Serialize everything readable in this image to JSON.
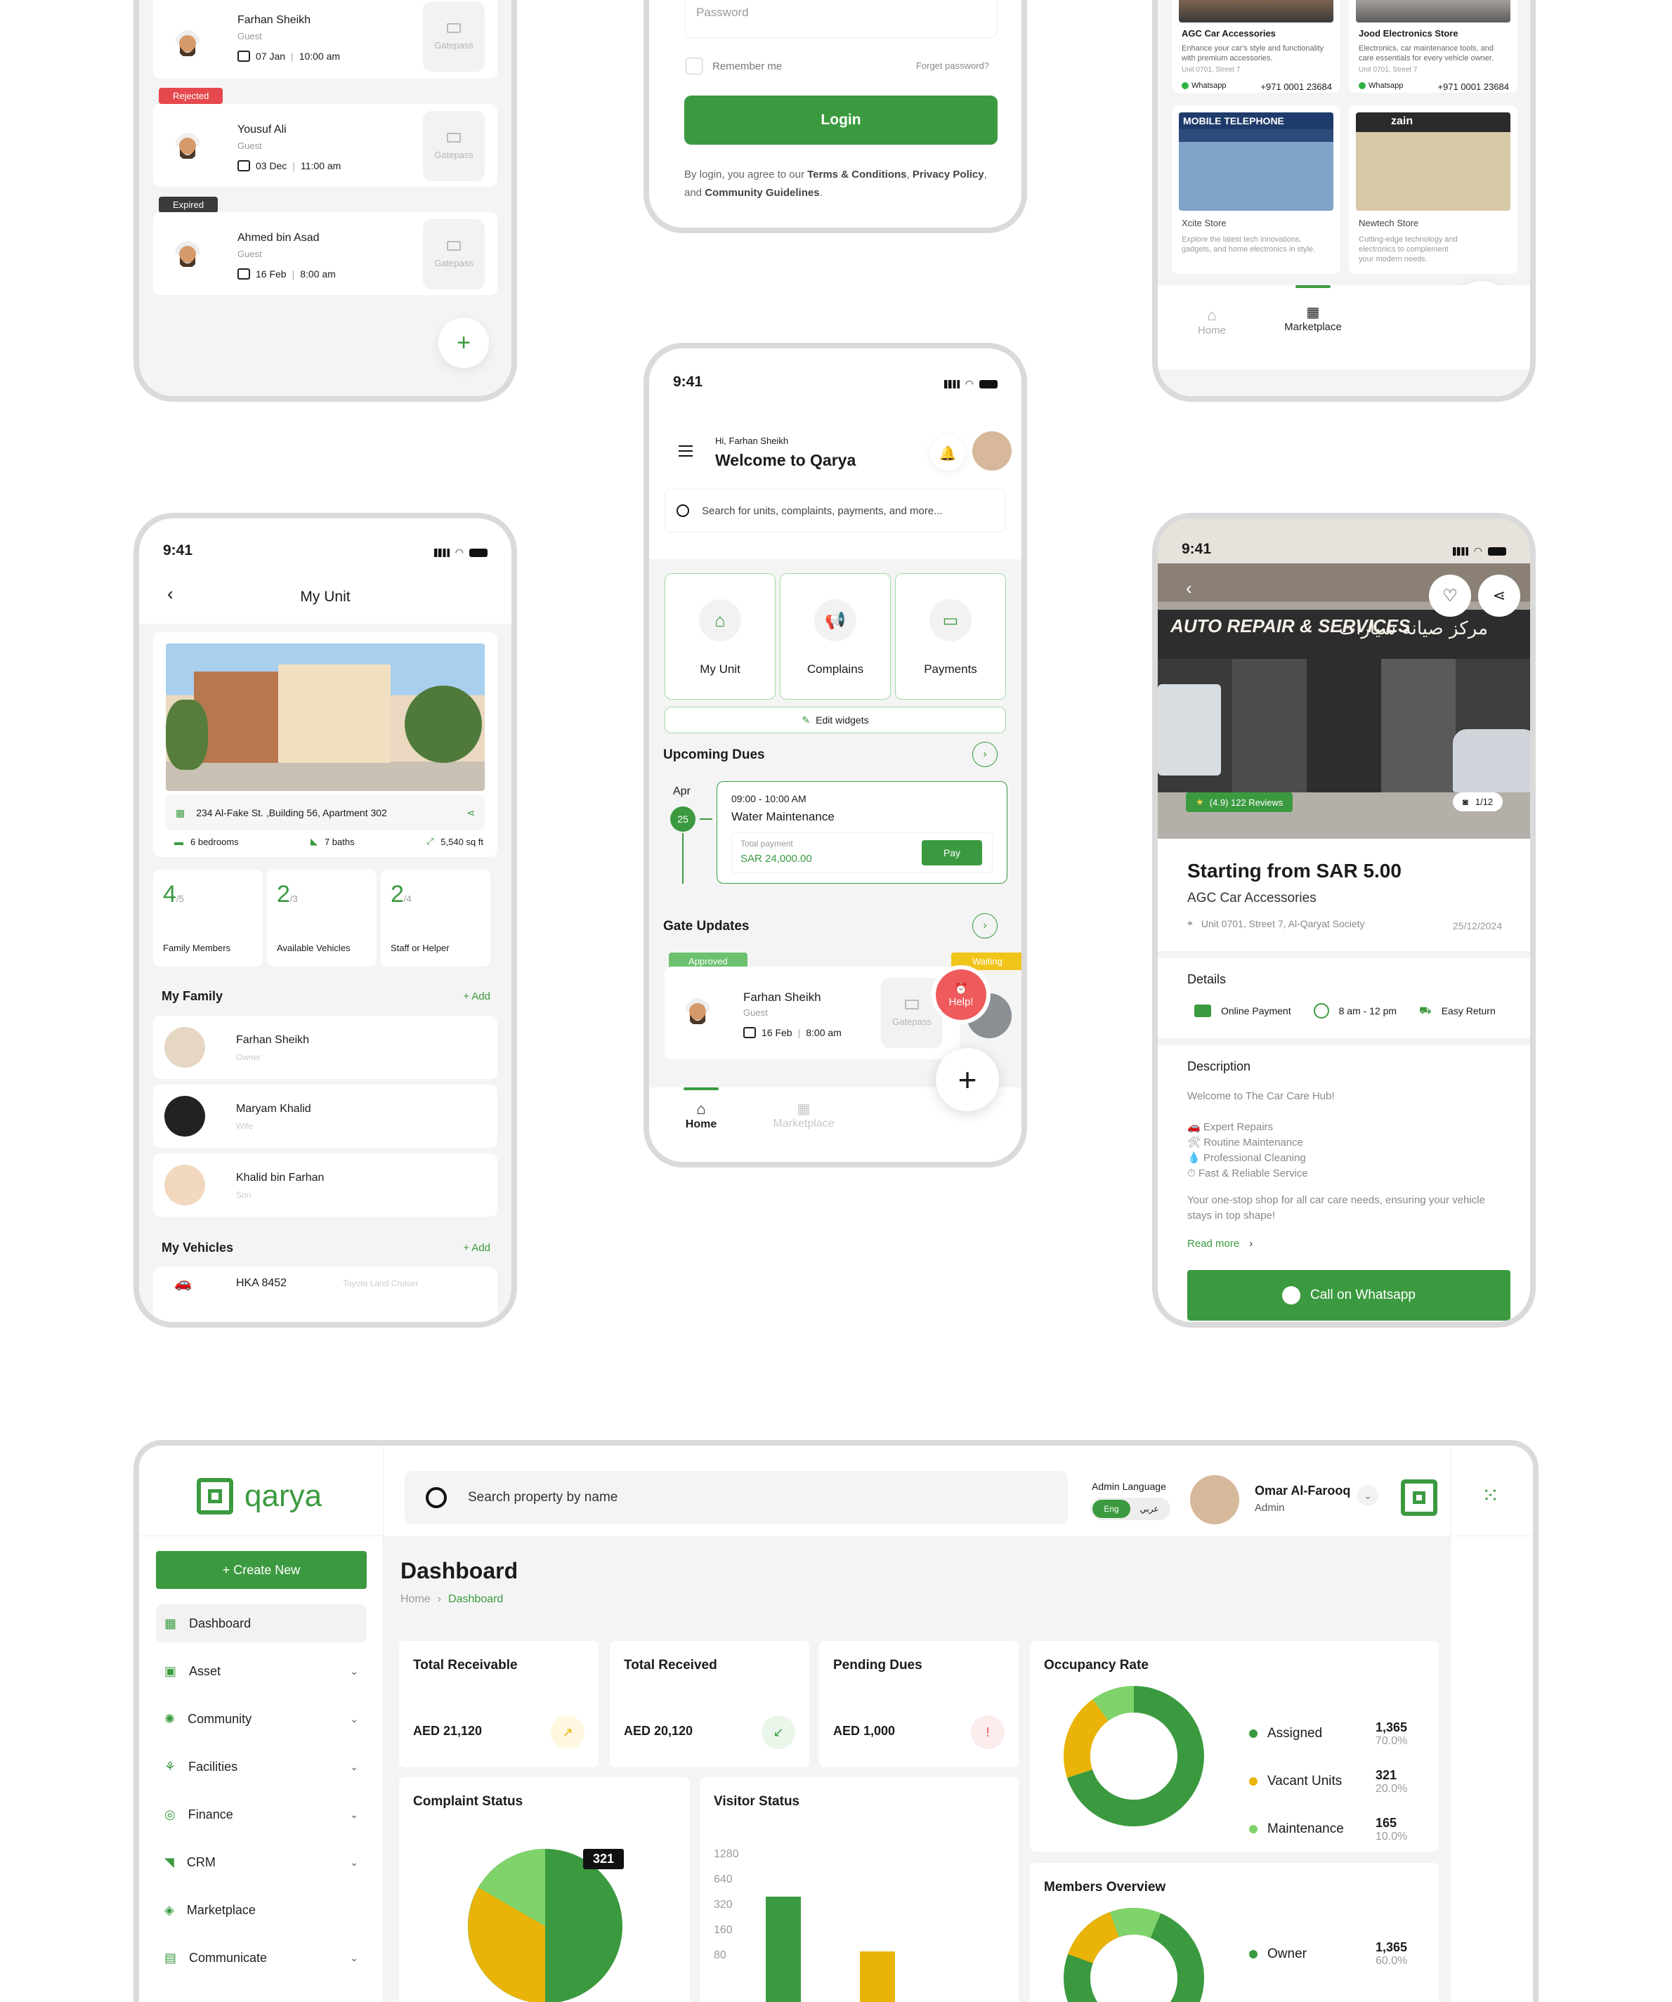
{
  "gatepass_screen": {
    "entries": [
      {
        "name": "Farhan Sheikh",
        "role": "Guest",
        "date": "07 Jan",
        "time": "10:00 am",
        "status": ""
      },
      {
        "name": "Yousuf Ali",
        "role": "Guest",
        "date": "03 Dec",
        "time": "11:00 am",
        "status": "Rejected"
      },
      {
        "name": "Ahmed bin Asad",
        "role": "Guest",
        "date": "16 Feb",
        "time": "8:00 am",
        "status": "Expired"
      }
    ],
    "gatepass_label": "Gatepass",
    "fab": "+"
  },
  "login_screen": {
    "password_placeholder": "Password",
    "remember": "Remember me",
    "forgot": "Forget password?",
    "login_btn": "Login",
    "terms_prefix": "By login, you agree to our ",
    "terms": "Terms & Conditions",
    "privacy": "Privacy Policy",
    "and": ", and ",
    "guidelines": "Community Guidelines",
    "period": "."
  },
  "marketplace_screen": {
    "stores": [
      {
        "name": "AGC Car Accessories",
        "desc": "Enhance your car's style and functionality with premium accessories.",
        "addr": "Unit 0701, Street 7",
        "wa": "Whatsapp",
        "phone": "+971 0001 23684"
      },
      {
        "name": "Jood Electronics Store",
        "desc": "Electronics, car maintenance tools, and care essentials for every vehicle owner.",
        "addr": "Unit 0701, Street 7",
        "wa": "Whatsapp",
        "phone": "+971 0001 23684"
      },
      {
        "name": "Xcite Store",
        "desc": "Explore the latest tech innovations, gadgets, and home electronics in style.",
        "sign": "MOBILE TELEPHONE"
      },
      {
        "name": "Newtech Store",
        "desc": "Cutting-edge technology and electronics to complement your modern needs.",
        "sign": "zain"
      }
    ],
    "nav_home": "Home",
    "nav_market": "Marketplace"
  },
  "home_screen": {
    "time": "9:41",
    "greeting": "Hi, Farhan Sheikh",
    "welcome": "Welcome to Qarya",
    "search_placeholder": "Search for units, complaints, payments, and more...",
    "widgets": [
      "My Unit",
      "Complains",
      "Payments"
    ],
    "edit_widgets": "Edit widgets",
    "upcoming": "Upcoming Dues",
    "due_month": "Apr",
    "due_day": "25",
    "due_time": "09:00 - 10:00 AM",
    "due_title": "Water Maintenance",
    "total_label": "Total payment",
    "total_value": "SAR 24,000.00",
    "pay": "Pay",
    "gate_updates": "Gate Updates",
    "approved": "Approved",
    "waiting": "Waiting",
    "gate_name": "Farhan Sheikh",
    "gate_role": "Guest",
    "gate_date": "16 Feb",
    "gate_time": "8:00 am",
    "gatepass": "Gatepass",
    "help": "Help!",
    "nav_home": "Home",
    "nav_market": "Marketplace"
  },
  "unit_screen": {
    "time": "9:41",
    "title": "My Unit",
    "address": "234 Al-Fake St. ,Building 56, Apartment 302",
    "bedrooms": "6 bedrooms",
    "baths": "7 baths",
    "area": "5,540 sq ft",
    "stats": [
      {
        "num": "4",
        "den": "/5",
        "label": "Family Members"
      },
      {
        "num": "2",
        "den": "/3",
        "label": "Available Vehicles"
      },
      {
        "num": "2",
        "den": "/4",
        "label": "Staff or Helper"
      }
    ],
    "family_title": "My Family",
    "add": "+ Add",
    "family": [
      {
        "name": "Farhan Sheikh",
        "role": "Owner"
      },
      {
        "name": "Maryam Khalid",
        "role": "Wife"
      },
      {
        "name": "Khalid bin Farhan",
        "role": "Son"
      }
    ],
    "vehicles_title": "My Vehicles",
    "vehicle_plate": "HKA 8452",
    "vehicle_model": "Toyota Land Cruiser"
  },
  "store_screen": {
    "time": "9:41",
    "sign_en": "AUTO REPAIR & SERVICES",
    "sign_ar": "مركز صيانة سيارات",
    "rating": "(4.9) 122 Reviews",
    "photos": "1/12",
    "price": "Starting from SAR 5.00",
    "store": "AGC Car Accessories",
    "address": "Unit 0701, Street 7, Al-Qaryat Society",
    "date": "25/12/2024",
    "details": "Details",
    "d1": "Online Payment",
    "d2": "8 am - 12 pm",
    "d3": "Easy Return",
    "desc_title": "Description",
    "desc_intro": "Welcome to The Car Care Hub!",
    "bullets": [
      "🚗 Expert Repairs",
      "🛠 Routine Maintenance",
      "💧 Professional Cleaning",
      "⏱ Fast & Reliable Service"
    ],
    "desc_body": "Your one-stop shop for all car care needs, ensuring your vehicle stays in top shape!",
    "read_more": "Read more",
    "call": "Call on Whatsapp"
  },
  "dashboard": {
    "logo": "qarya",
    "search_placeholder": "Search property by name",
    "admin_lang": "Admin Language",
    "lang_en": "Eng",
    "lang_ar": "عربي",
    "user_name": "Omar Al-Farooq",
    "user_role": "Admin",
    "create": "+ Create New",
    "menu": [
      "Dashboard",
      "Asset",
      "Community",
      "Facilities",
      "Finance",
      "CRM",
      "Marketplace",
      "Communicate"
    ],
    "page_title": "Dashboard",
    "crumb_home": "Home",
    "crumb_current": "Dashboard",
    "cards": [
      {
        "title": "Total Receivable",
        "value": "AED 21,120",
        "icon": "↗"
      },
      {
        "title": "Total Received",
        "value": "AED 20,120",
        "icon": "↙"
      },
      {
        "title": "Pending Dues",
        "value": "AED 1,000",
        "icon": "!"
      }
    ],
    "occupancy_title": "Occupancy Rate",
    "occupancy": [
      {
        "label": "Assigned",
        "value": "1,365",
        "pct": "70.0%",
        "color": "#3b9a3f",
        "frac": 0.7
      },
      {
        "label": "Vacant Units",
        "value": "321",
        "pct": "20.0%",
        "color": "#eab308",
        "frac": 0.2
      },
      {
        "label": "Maintenance",
        "value": "165",
        "pct": "10.0%",
        "color": "#7fd36a",
        "frac": 0.1
      }
    ],
    "members_title": "Members Overview",
    "members": [
      {
        "label": "Owner",
        "value": "1,365",
        "pct": "60.0%"
      }
    ],
    "complaint_title": "Complaint Status",
    "complaint_badge": "321",
    "visitor_title": "Visitor Status",
    "visitor_ticks": [
      "1280",
      "640",
      "320",
      "160",
      "80"
    ]
  },
  "colors": {
    "brand": "#3b9a3f",
    "yellow": "#eab308",
    "lightgreen": "#7fd36a",
    "danger": "#e5484d",
    "dark": "#3a3a3a"
  }
}
